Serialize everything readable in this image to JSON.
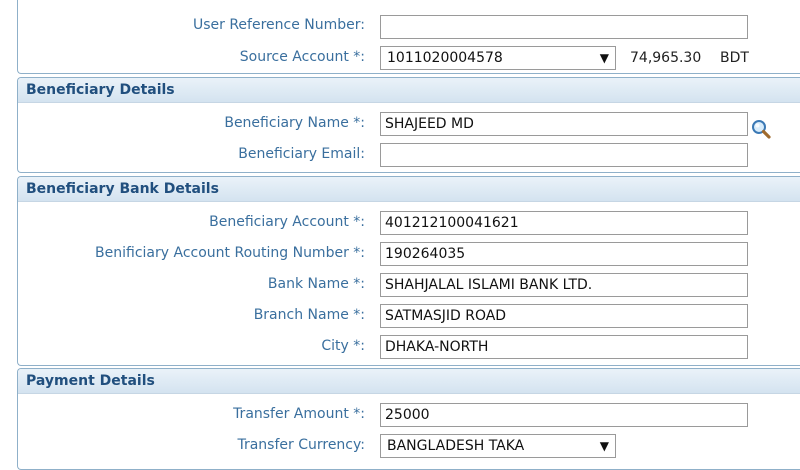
{
  "account_section": {
    "user_reference_label": "User Reference Number:",
    "user_reference_value": "",
    "source_account_label": "Source Account *:",
    "source_account_value": "1011020004578",
    "balance": "74,965.30",
    "currency": "BDT"
  },
  "beneficiary_details": {
    "title": "Beneficiary Details",
    "name_label": "Beneficiary Name *:",
    "name_value": "SHAJEED MD",
    "email_label": "Beneficiary Email:",
    "email_value": "",
    "lookup_icon": "magnifier-icon"
  },
  "beneficiary_bank_details": {
    "title": "Beneficiary Bank Details",
    "account_label": "Beneficiary Account *:",
    "account_value": "401212100041621",
    "routing_label": "Benificiary Account Routing Number *:",
    "routing_value": "190264035",
    "bank_name_label": "Bank Name *:",
    "bank_name_value": "SHAHJALAL ISLAMI BANK LTD.",
    "branch_name_label": "Branch Name *:",
    "branch_name_value": "SATMASJID ROAD",
    "city_label": "City *:",
    "city_value": "DHAKA-NORTH"
  },
  "payment_details": {
    "title": "Payment Details",
    "amount_label": "Transfer Amount *:",
    "amount_value": "25000",
    "currency_label": "Transfer Currency:",
    "currency_value": "BANGLADESH TAKA"
  },
  "colors": {
    "header_gradient_top": "#eaf2f9",
    "header_gradient_bottom": "#d4e3f0",
    "section_title": "#214f7e",
    "label": "#3a6f9e",
    "panel_border": "#8fb0c9"
  }
}
